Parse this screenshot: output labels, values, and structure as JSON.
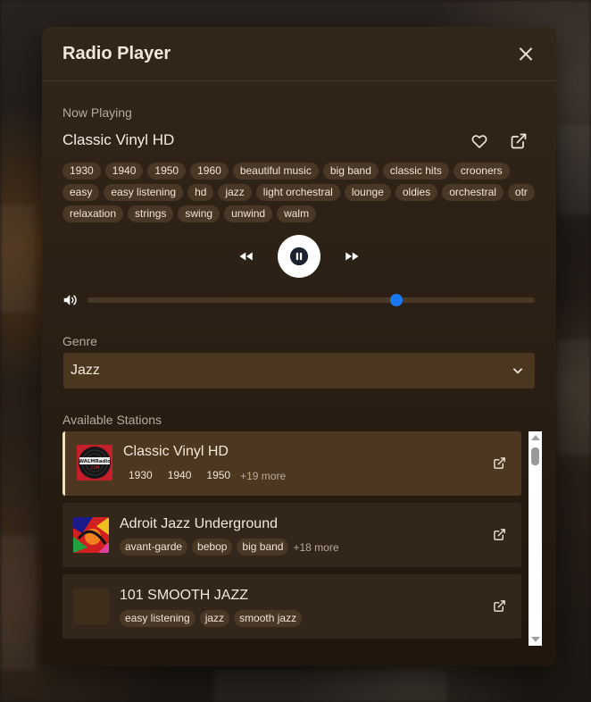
{
  "modal": {
    "title": "Radio Player",
    "now_playing_label": "Now Playing",
    "station_title": "Classic Vinyl HD",
    "tags": [
      "1930",
      "1940",
      "1950",
      "1960",
      "beautiful music",
      "big band",
      "classic hits",
      "crooners",
      "easy",
      "easy listening",
      "hd",
      "jazz",
      "light orchestral",
      "lounge",
      "oldies",
      "orchestral",
      "otr",
      "relaxation",
      "strings",
      "swing",
      "unwind",
      "walm"
    ],
    "controls": {
      "prev_icon": "rewind-icon",
      "play_icon": "pause-icon",
      "next_icon": "fast-forward-icon",
      "state": "playing"
    },
    "volume": {
      "icon": "speaker-icon",
      "level": 0.69
    },
    "genre_label": "Genre",
    "genre_selected": "Jazz",
    "stations_label": "Available Stations",
    "stations": [
      {
        "name": "Classic Vinyl HD",
        "tags": [
          "1930",
          "1940",
          "1950"
        ],
        "more": "+19 more",
        "active": true,
        "logo_text": "WALMRadio.COM"
      },
      {
        "name": "Adroit Jazz Underground",
        "tags": [
          "avant-garde",
          "bebop",
          "big band"
        ],
        "more": "+18 more",
        "active": false
      },
      {
        "name": "101 SMOOTH JAZZ",
        "tags": [
          "easy listening",
          "jazz",
          "smooth jazz"
        ],
        "more": "",
        "active": false
      }
    ]
  },
  "colors": {
    "accent": "#1a78f2",
    "modal_bg": "#2b2015",
    "tag_bg": "#4a3826",
    "active_station_bg": "#4d3720",
    "select_bg": "#4b371f"
  }
}
